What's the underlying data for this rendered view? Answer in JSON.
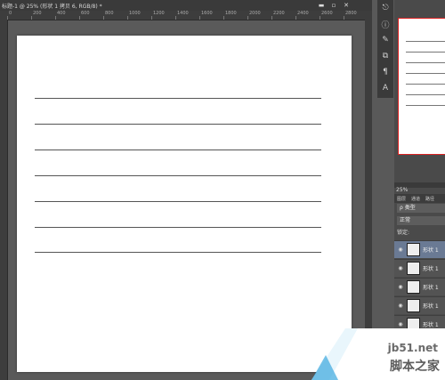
{
  "document_tab": {
    "title": "标题-1 @ 25% (形状 1 拷贝 6, RGB/8) *"
  },
  "window_controls": {
    "minimize": "▬",
    "maximize": "▫",
    "close": "✕"
  },
  "ruler": {
    "ticks": [
      "0",
      "200",
      "400",
      "600",
      "800",
      "1000",
      "1200",
      "1400",
      "1600",
      "1800",
      "2000",
      "2200",
      "2400",
      "2600",
      "2800"
    ]
  },
  "tools": [
    {
      "icon": "history-icon",
      "glyph": "⎋"
    },
    {
      "icon": "info-icon",
      "glyph": "ⓘ"
    },
    {
      "icon": "brush-icon",
      "glyph": "✎"
    },
    {
      "icon": "clone-icon",
      "glyph": "⧉"
    },
    {
      "icon": "paragraph-icon",
      "glyph": "¶"
    },
    {
      "icon": "character-icon",
      "glyph": "A"
    }
  ],
  "navigator": {
    "zoom": "25%"
  },
  "layers_panel": {
    "tabs": [
      "图层",
      "通道",
      "路径"
    ],
    "filter_label": "ρ 类型",
    "blend_mode": "正常",
    "lock_label": "锁定:",
    "layers": [
      {
        "name": "形状 1",
        "selected": true
      },
      {
        "name": "形状 1",
        "selected": false
      },
      {
        "name": "形状 1",
        "selected": false
      },
      {
        "name": "形状 1",
        "selected": false
      },
      {
        "name": "形状 1",
        "selected": false
      }
    ]
  },
  "watermark": {
    "url": "jb51.net",
    "site_name": "脚本之家"
  }
}
